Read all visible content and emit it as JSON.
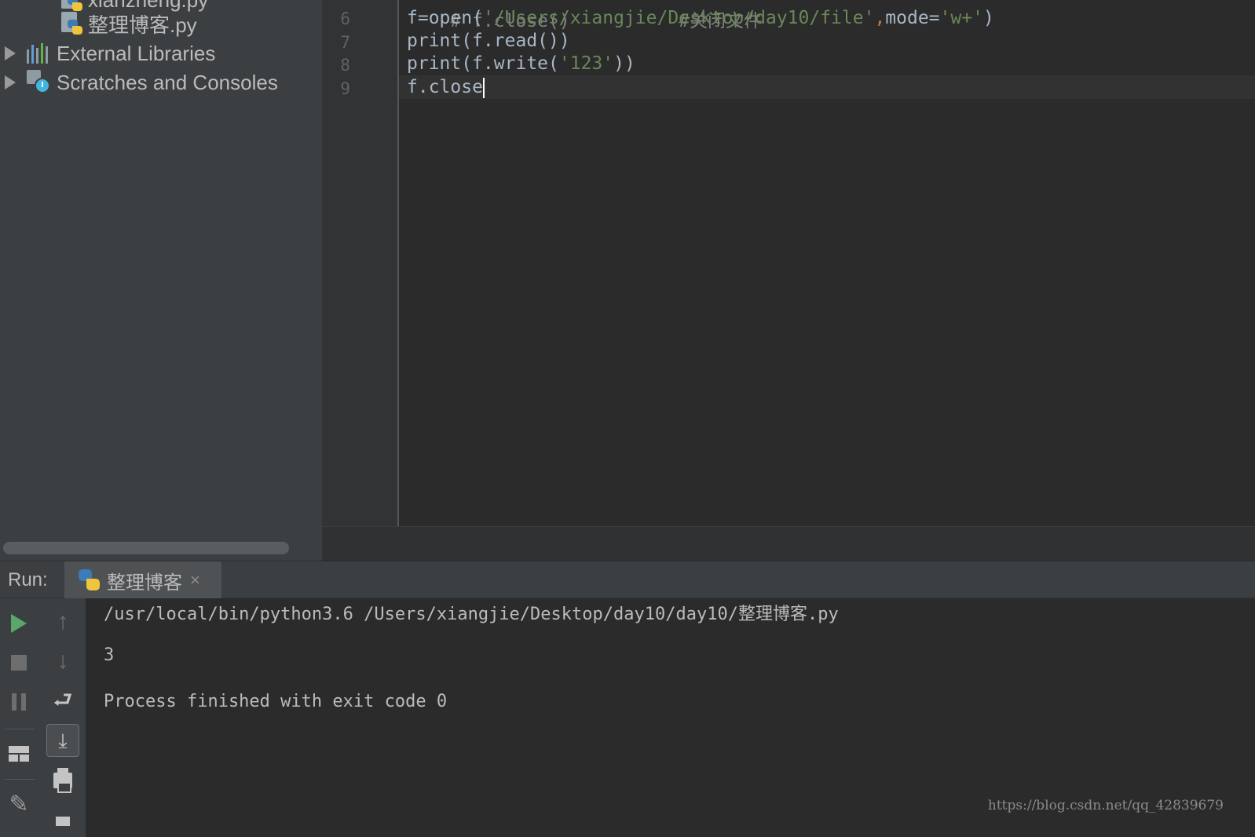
{
  "project_tree": {
    "items": [
      {
        "label": "xianzheng.py",
        "icon": "python-file-icon"
      },
      {
        "label": "整理博客.py",
        "icon": "python-file-icon"
      },
      {
        "label": "External Libraries",
        "icon": "libraries-icon"
      },
      {
        "label": "Scratches and Consoles",
        "icon": "scratches-icon"
      }
    ]
  },
  "editor": {
    "partial_top_line": {
      "code": "# f.close()",
      "comment": "#关闭文件"
    },
    "lines": [
      {
        "number": "6",
        "parts": [
          "f=open(",
          "'/Users/xiangjie/Desktop/day10/file'",
          ",",
          "mode=",
          "'w+'",
          ")"
        ]
      },
      {
        "number": "7",
        "code": "print(f.read())"
      },
      {
        "number": "8",
        "parts": [
          "print(f.write(",
          "'123'",
          "))"
        ]
      },
      {
        "number": "9",
        "code": "f.close"
      }
    ],
    "colors": {
      "string": "#6a8759",
      "keyword": "#cc7832",
      "default": "#a9b7c6"
    }
  },
  "run_panel": {
    "title": "Run:",
    "tab_label": "整理博客",
    "tab_close": "×",
    "toolbar": [
      "play-icon",
      "stop-icon",
      "pause-icon",
      "layout-icon",
      "pin-icon",
      "up-arrow-icon",
      "down-arrow-icon",
      "soft-wrap-icon",
      "scroll-to-end-icon",
      "print-icon",
      "trash-icon"
    ],
    "console": [
      "/usr/local/bin/python3.6 /Users/xiangjie/Desktop/day10/day10/整理博客.py",
      "3",
      "Process finished with exit code 0"
    ]
  },
  "watermark": "https://blog.csdn.net/qq_42839679"
}
